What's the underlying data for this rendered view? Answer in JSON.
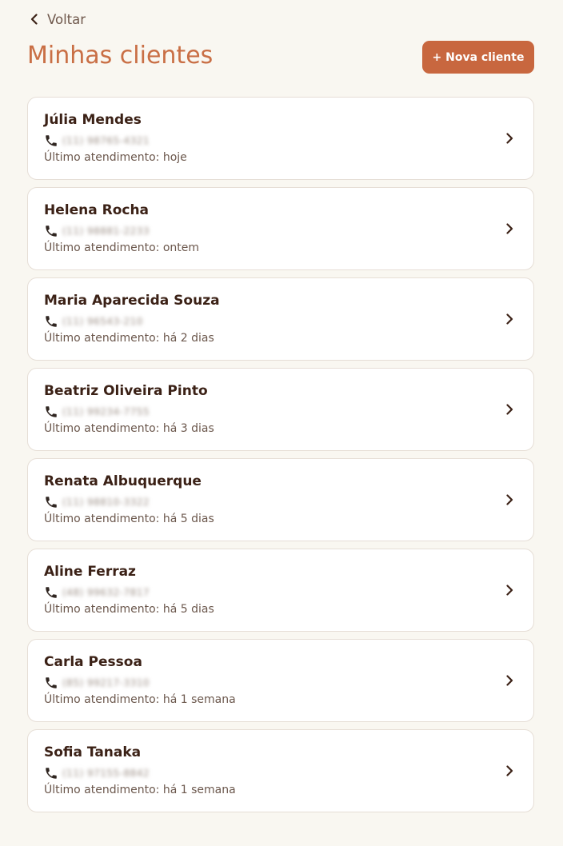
{
  "nav": {
    "back_label": "Voltar"
  },
  "header": {
    "title": "Minhas clientes",
    "new_button_label": "+ Nova cliente"
  },
  "theme": {
    "accent": "#c8673f",
    "title_color": "#c96f45",
    "background": "#f9f7f1"
  },
  "clients": [
    {
      "name": "Júlia Mendes",
      "phone": "(11) 98765-4321",
      "last_visit": "Último atendimento: hoje"
    },
    {
      "name": "Helena Rocha",
      "phone": "(11) 98881-2233",
      "last_visit": "Último atendimento: ontem"
    },
    {
      "name": "Maria Aparecida Souza",
      "phone": "(11) 96543-210",
      "last_visit": "Último atendimento: há 2 dias"
    },
    {
      "name": "Beatriz Oliveira Pinto",
      "phone": "(11) 99234-7755",
      "last_visit": "Último atendimento: há 3 dias"
    },
    {
      "name": "Renata Albuquerque",
      "phone": "(11) 98810-3322",
      "last_visit": "Último atendimento: há 5 dias"
    },
    {
      "name": "Aline Ferraz",
      "phone": "(48) 99632-7817",
      "last_visit": "Último atendimento: há 5 dias"
    },
    {
      "name": "Carla Pessoa",
      "phone": "(85) 99217-3310",
      "last_visit": "Último atendimento: há 1 semana"
    },
    {
      "name": "Sofia Tanaka",
      "phone": "(11) 97155-8842",
      "last_visit": "Último atendimento: há 1 semana"
    }
  ]
}
